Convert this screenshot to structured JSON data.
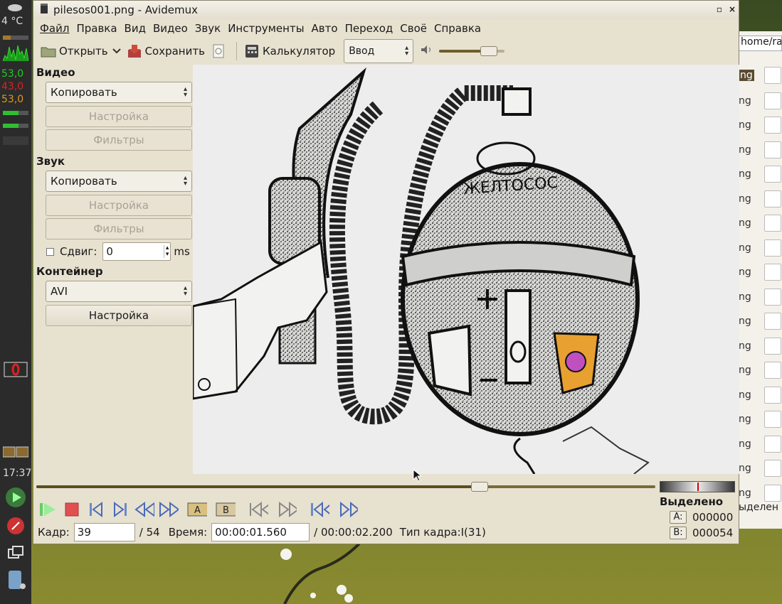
{
  "system_panel": {
    "temperature": "4 °C",
    "cpu_values": [
      "53,0",
      "43,0",
      "53,0"
    ],
    "cpu_colors": [
      "#22cc22",
      "#dd2222",
      "#dd9922"
    ],
    "clock": "17:37"
  },
  "window": {
    "title": "pilesos001.png - Avidemux",
    "minimize_label": "▫",
    "close_label": "×"
  },
  "menu": [
    "Файл",
    "Правка",
    "Вид",
    "Видео",
    "Звук",
    "Инструменты",
    "Авто",
    "Переход",
    "Своё",
    "Справка"
  ],
  "toolbar": {
    "open_label": "Открыть",
    "save_label": "Сохранить",
    "calculator_label": "Калькулятор",
    "input_mode": "Ввод",
    "volume_level": 0.85
  },
  "panel": {
    "video": {
      "section": "Видео",
      "codec": "Копировать",
      "settings": "Настройка",
      "filters": "Фильтры"
    },
    "audio": {
      "section": "Звук",
      "codec": "Копировать",
      "settings": "Настройка",
      "filters": "Фильтры",
      "shift_label": "Сдвиг:",
      "shift_value": "0",
      "shift_unit": "ms"
    },
    "container": {
      "section": "Контейнер",
      "format": "AVI",
      "settings": "Настройка"
    }
  },
  "video_preview": {
    "logo_text": "ЖЕЛТОСОС"
  },
  "timeline": {
    "position_fraction": 0.7222
  },
  "status": {
    "frame_label": "Кадр:",
    "frame_value": "39",
    "frame_total": "/ 54",
    "time_label": "Время:",
    "time_value": "00:00:01.560",
    "duration": "/ 00:00:02.200",
    "frame_type": "Тип кадра:I(31)"
  },
  "selection": {
    "label": "Выделено",
    "a_label": "A:",
    "a_value": "000000",
    "b_label": "B:",
    "b_value": "000054"
  },
  "background_window": {
    "path": "home/rat",
    "item_suffix": "ng",
    "selected_label": "ыделен"
  }
}
